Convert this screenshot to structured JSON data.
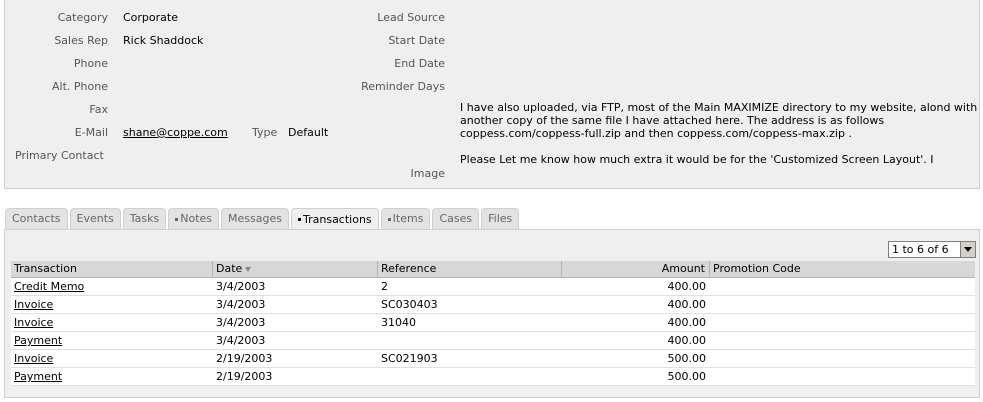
{
  "details": {
    "category_label": "Category",
    "category_value": "Corporate",
    "sales_rep_label": "Sales Rep",
    "sales_rep_value": "Rick Shaddock",
    "phone_label": "Phone",
    "alt_phone_label": "Alt. Phone",
    "fax_label": "Fax",
    "email_label": "E-Mail",
    "email_value": "shane@coppe.com",
    "type_label": "Type",
    "type_value": "Default",
    "primary_contact_label": "Primary Contact",
    "lead_source_label": "Lead Source",
    "start_date_label": "Start Date",
    "end_date_label": "End Date",
    "reminder_days_label": "Reminder Days",
    "image_label": "Image",
    "notes_p1": "I have also uploaded, via FTP, most of the Main MAXIMIZE directory to my website, alond with another copy of the same file I have attached here. The address is as follows coppess.com/coppess-full.zip and then coppess.com/coppess-max.zip .",
    "notes_p2": "Please Let me know how much extra it would be for the 'Customized Screen Layout'. I"
  },
  "tabs": [
    {
      "label": "Contacts",
      "dot": false
    },
    {
      "label": "Events",
      "dot": false
    },
    {
      "label": "Tasks",
      "dot": false
    },
    {
      "label": "Notes",
      "dot": true
    },
    {
      "label": "Messages",
      "dot": false
    },
    {
      "label": "Transactions",
      "dot": true,
      "active": true
    },
    {
      "label": "Items",
      "dot": true
    },
    {
      "label": "Cases",
      "dot": false
    },
    {
      "label": "Files",
      "dot": false
    }
  ],
  "pager": {
    "value": "1 to 6 of 6"
  },
  "table": {
    "columns": [
      "Transaction",
      "Date",
      "Reference",
      "Amount",
      "Promotion Code"
    ],
    "sorted_column": "Date",
    "rows": [
      {
        "transaction": "Credit Memo",
        "date": "3/4/2003",
        "reference": "2",
        "amount": "400.00",
        "promotion": ""
      },
      {
        "transaction": "Invoice",
        "date": "3/4/2003",
        "reference": "SC030403",
        "amount": "400.00",
        "promotion": ""
      },
      {
        "transaction": "Invoice",
        "date": "3/4/2003",
        "reference": "31040",
        "amount": "400.00",
        "promotion": ""
      },
      {
        "transaction": "Payment",
        "date": "3/4/2003",
        "reference": "",
        "amount": "400.00",
        "promotion": ""
      },
      {
        "transaction": "Invoice",
        "date": "2/19/2003",
        "reference": "SC021903",
        "amount": "500.00",
        "promotion": ""
      },
      {
        "transaction": "Payment",
        "date": "2/19/2003",
        "reference": "",
        "amount": "500.00",
        "promotion": ""
      }
    ]
  },
  "colors": {
    "panel_bg": "#efefef",
    "header_bg": "#d7d7d7",
    "tab_bg": "#e3e3e3"
  }
}
